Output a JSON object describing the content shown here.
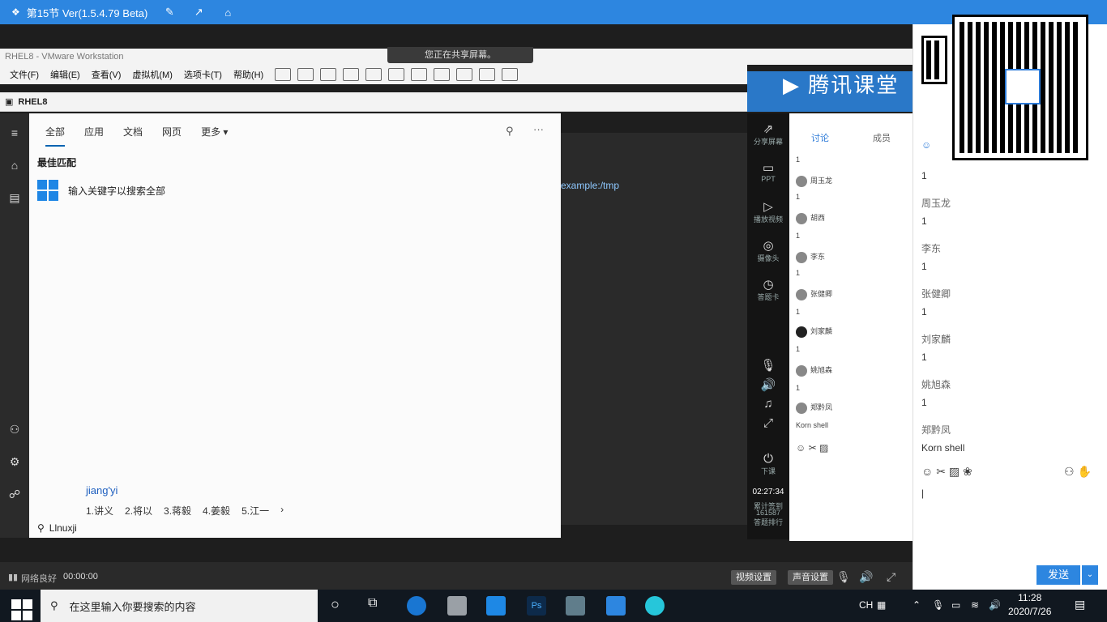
{
  "app": {
    "title": "第15节 Ver(1.5.4.79 Beta)",
    "share_banner": "您正在共享屏幕。"
  },
  "vmware": {
    "window_title": "RHEL8 - VMware Workstation",
    "menu": [
      "文件(F)",
      "编辑(E)",
      "查看(V)",
      "虚拟机(M)",
      "选项卡(T)",
      "帮助(H)"
    ],
    "tab": "RHEL8"
  },
  "search": {
    "tabs": [
      "全部",
      "应用",
      "文档",
      "网页",
      "更多"
    ],
    "best_match": "最佳匹配",
    "hint": "输入关键字以搜索全部",
    "ime_pinyin": "jiang'yi",
    "ime_candidates": [
      "1.讲义",
      "2.将以",
      "3.蒋毅",
      "4.姜毅",
      "5.江一"
    ],
    "query": "Llnuxji"
  },
  "terminal": {
    "path": "example:/tmp"
  },
  "tools": {
    "share_screen": "分享屏幕",
    "ppt": "PPT",
    "play_video": "播放视频",
    "camera": "摄像头",
    "answer": "答题卡",
    "end_class": "下课",
    "elapsed": "02:27:34",
    "signin_label": "累计签到",
    "signin_count": "161587",
    "signin_sub": "答题排行"
  },
  "discussion_small": {
    "tab_discuss": "讨论",
    "tab_members": "成员",
    "messages": [
      {
        "name": "",
        "text": "1"
      },
      {
        "name": "周玉龙",
        "text": "1"
      },
      {
        "name": "胡西",
        "text": "1"
      },
      {
        "name": "李东",
        "text": "1"
      },
      {
        "name": "张健卿",
        "text": "1"
      },
      {
        "name": "刘家麟",
        "text": "1"
      },
      {
        "name": "姚旭森",
        "text": "1"
      },
      {
        "name": "郑黔凤",
        "text": "Korn shell"
      }
    ]
  },
  "chat": {
    "messages": [
      {
        "name": "",
        "text": "1"
      },
      {
        "name": "周玉龙",
        "text": "1"
      },
      {
        "name": "李东",
        "text": "1"
      },
      {
        "name": "张健卿",
        "text": "1"
      },
      {
        "name": "刘家麟",
        "text": "1"
      },
      {
        "name": "姚旭森",
        "text": "1"
      },
      {
        "name": "郑黔凤",
        "text": "Korn shell"
      }
    ],
    "send_label": "发送",
    "send_more": "⌄"
  },
  "statusbar": {
    "network": "网络良好",
    "time": "00:00:00",
    "video_settings": "视频设置",
    "voice_settings": "声音设置"
  },
  "taskbar": {
    "search_placeholder": "在这里输入你要搜索的内容",
    "lang": "CH",
    "time": "11:28",
    "date": "2020/7/26"
  }
}
